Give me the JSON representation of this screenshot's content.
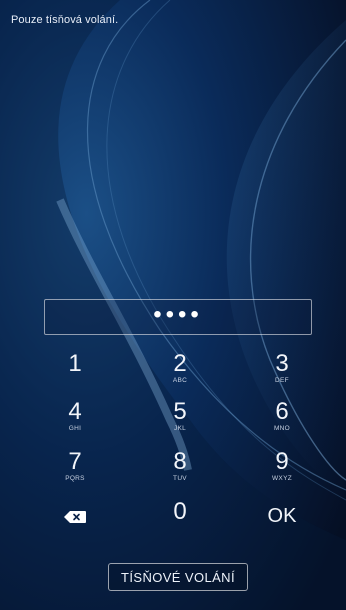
{
  "status": {
    "text": "Pouze tísňová volání."
  },
  "pin": {
    "masked": "••••"
  },
  "keypad": [
    {
      "digit": "1",
      "letters": ""
    },
    {
      "digit": "2",
      "letters": "ABC"
    },
    {
      "digit": "3",
      "letters": "DEF"
    },
    {
      "digit": "4",
      "letters": "GHI"
    },
    {
      "digit": "5",
      "letters": "JKL"
    },
    {
      "digit": "6",
      "letters": "MNO"
    },
    {
      "digit": "7",
      "letters": "PQRS"
    },
    {
      "digit": "8",
      "letters": "TUV"
    },
    {
      "digit": "9",
      "letters": "WXYZ"
    },
    {
      "digit": "",
      "letters": "",
      "icon": "backspace-icon"
    },
    {
      "digit": "0",
      "letters": ""
    },
    {
      "digit": "OK",
      "letters": ""
    }
  ],
  "emergency": {
    "label": "TÍSŇOVÉ VOLÁNÍ"
  },
  "colors": {
    "background": "#061a3a",
    "accent": "#ffffff"
  }
}
